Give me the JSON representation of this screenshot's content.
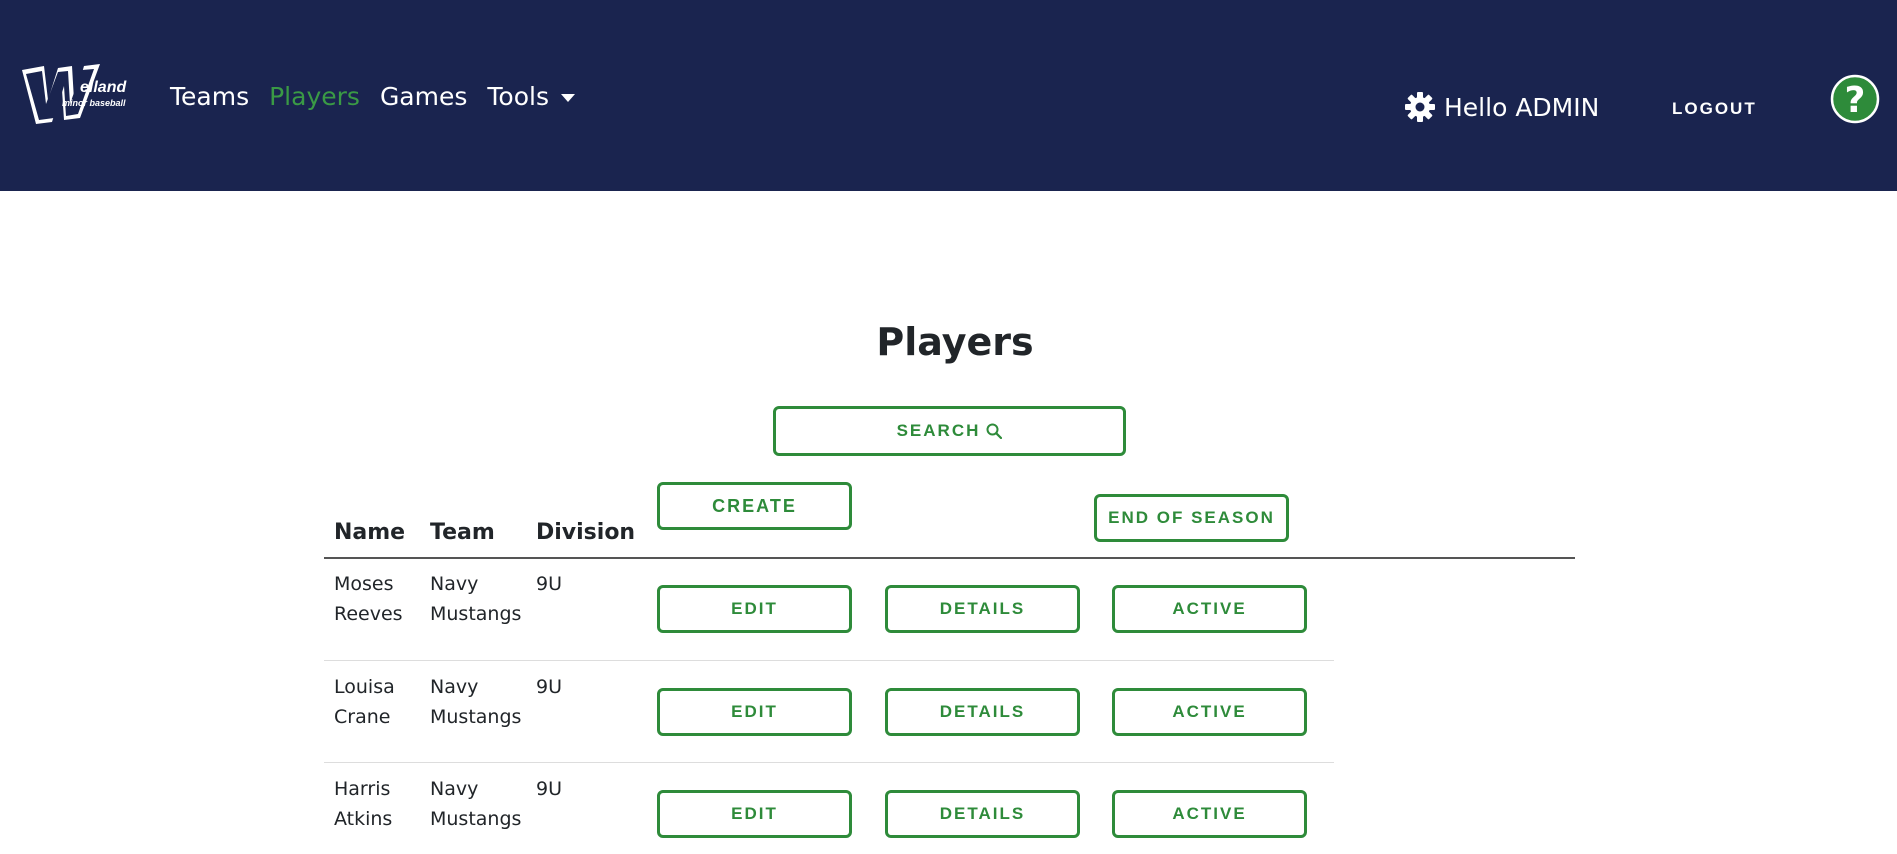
{
  "brand": {
    "logo_text": "Welland",
    "logo_subtext": "minor baseball"
  },
  "nav": {
    "links": [
      {
        "label": "Teams",
        "active": false
      },
      {
        "label": "Players",
        "active": true
      },
      {
        "label": "Games",
        "active": false
      },
      {
        "label": "Tools",
        "active": false,
        "dropdown": true
      }
    ],
    "greeting": "Hello ADMIN",
    "logout_label": "LOGOUT",
    "help_icon": "question-circle-icon"
  },
  "page": {
    "title": "Players",
    "search_label": "SEARCH",
    "create_label": "CREATE",
    "end_of_season_label": "END OF SEASON"
  },
  "table": {
    "headers": [
      "Name",
      "Team",
      "Division"
    ],
    "rows": [
      {
        "name_first": "Moses",
        "name_last": "Reeves",
        "team_first": "Navy",
        "team_last": "Mustangs",
        "division": "9U"
      },
      {
        "name_first": "Louisa",
        "name_last": "Crane",
        "team_first": "Navy",
        "team_last": "Mustangs",
        "division": "9U"
      },
      {
        "name_first": "Harris",
        "name_last": "Atkins",
        "team_first": "Navy",
        "team_last": "Mustangs",
        "division": "9U"
      }
    ],
    "actions": {
      "edit": "EDIT",
      "details": "DETAILS",
      "active": "ACTIVE"
    }
  },
  "colors": {
    "navbar": "#1a244f",
    "accent_green": "#2e8b3a",
    "active_link": "#3a9a45"
  }
}
